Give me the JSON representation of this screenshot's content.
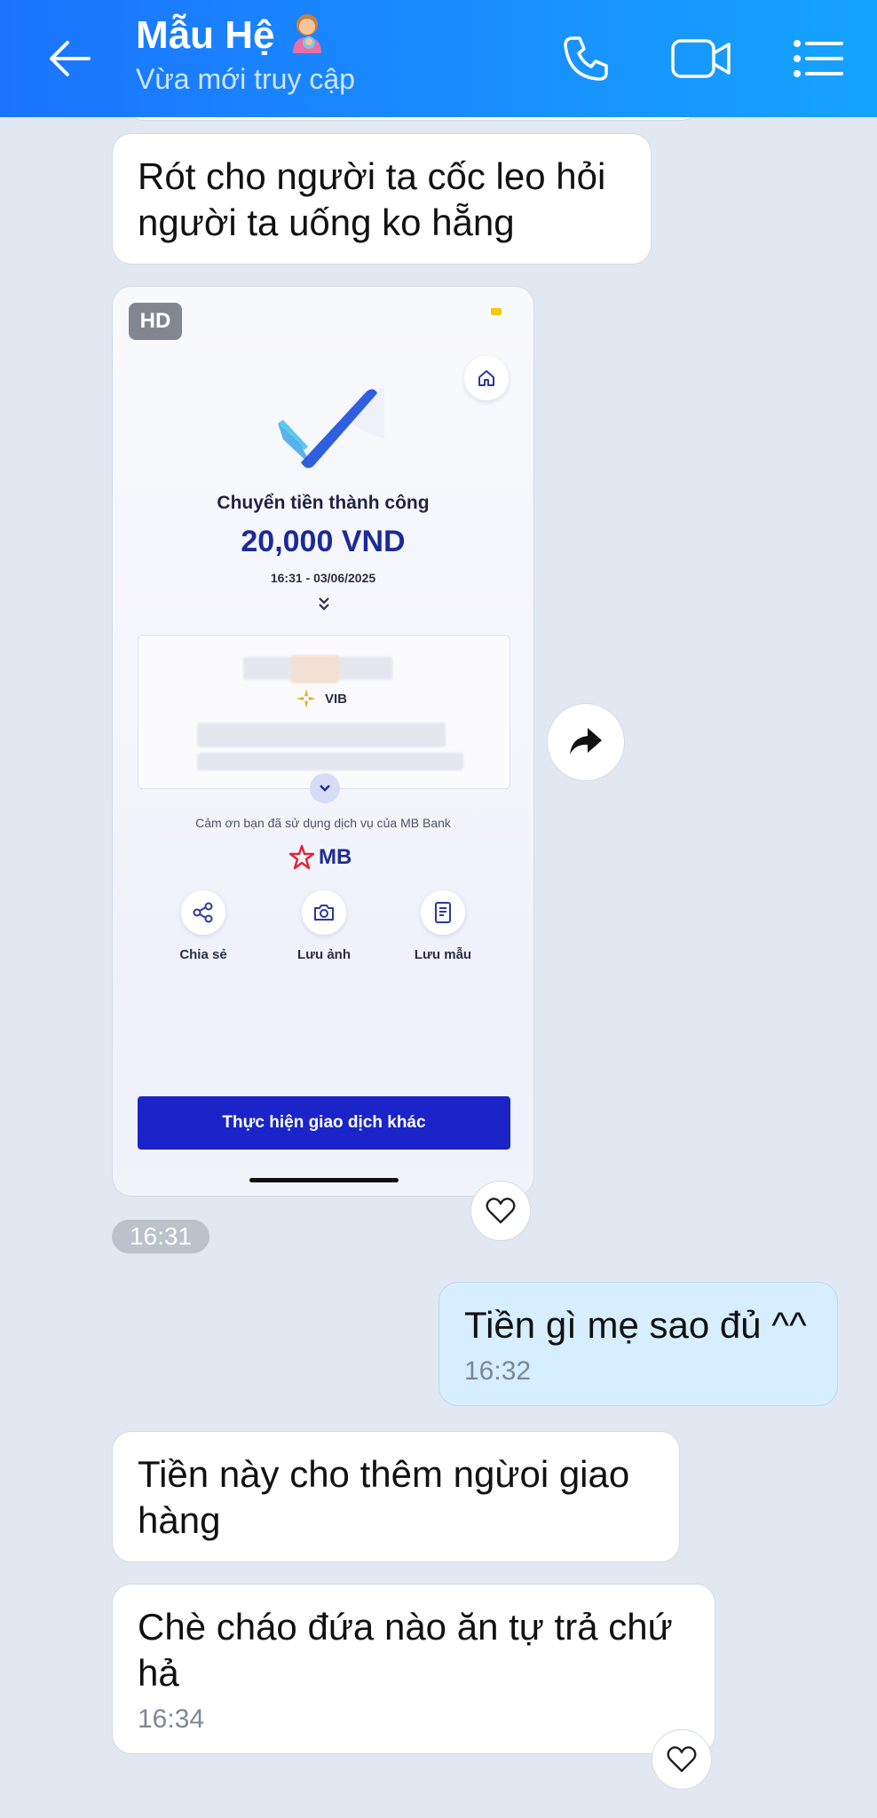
{
  "header": {
    "contact_name": "Mẫu Hệ",
    "status": "Vừa mới truy cập",
    "icons": [
      "back-arrow-icon",
      "phone-icon",
      "video-call-icon",
      "menu-list-icon"
    ]
  },
  "colors": {
    "header_gradient_start": "#1b74ff",
    "header_gradient_end": "#16a3ff",
    "bubble_incoming": "#ffffff",
    "bubble_outgoing": "#d6eeff",
    "chat_background": "#e2e8f1"
  },
  "messages": [
    {
      "from": "contact",
      "text": "Rót cho người ta cốc leo hỏi người ta uống ko hẵng"
    },
    {
      "from": "contact",
      "type": "image",
      "badge": "HD",
      "receipt": {
        "title": "Chuyển tiền thành công",
        "amount": "20,000 VND",
        "datetime": "16:31 - 03/06/2025",
        "bank_name": "VIB",
        "thanks": "Cảm ơn bạn đã sử dụng dịch vụ của MB Bank",
        "brand": "MB",
        "actions": [
          "Chia sẻ",
          "Lưu ảnh",
          "Lưu mẫu"
        ],
        "cta": "Thực hiện giao dịch khác"
      }
    },
    {
      "from": "system",
      "time": "16:31"
    },
    {
      "from": "me",
      "text": "Tiền gì mẹ sao đủ ^^",
      "time": "16:32"
    },
    {
      "from": "contact",
      "text": "Tiền này cho thêm ngừoi giao hàng"
    },
    {
      "from": "contact",
      "text": "Chè cháo đứa nào ăn tự trả chứ hả",
      "time": "16:34"
    }
  ]
}
